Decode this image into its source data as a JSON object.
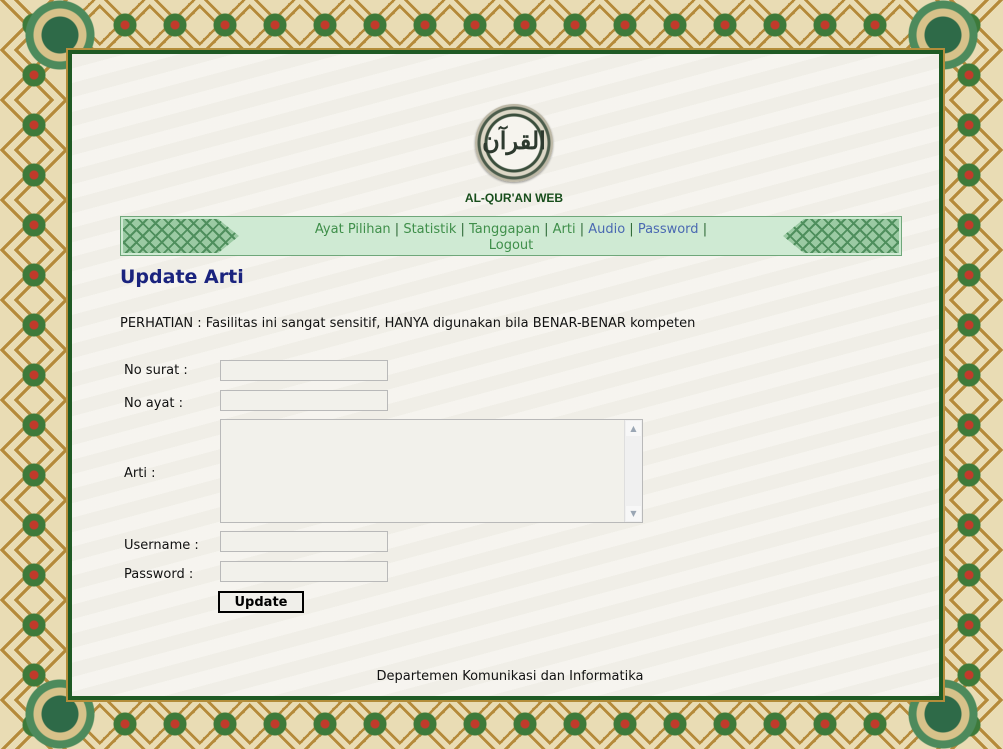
{
  "site": {
    "title": "AL-QUR'AN WEB",
    "logo_text": "القرآن"
  },
  "nav": [
    {
      "label": "Ayat Pilihan",
      "sep": " | "
    },
    {
      "label": "Statistik",
      "sep": " | "
    },
    {
      "label": "Tanggapan",
      "sep": " | "
    },
    {
      "label": "Arti",
      "sep": " | "
    },
    {
      "label": "Audio",
      "sep": " | "
    },
    {
      "label": "Password",
      "sep": " | "
    },
    {
      "label": "Logout",
      "sep": ""
    }
  ],
  "page": {
    "heading": "Update Arti",
    "notice": "PERHATIAN : Fasilitas ini sangat sensitif, HANYA digunakan bila BENAR-BENAR kompeten"
  },
  "form": {
    "no_surat_label": "No surat :",
    "no_surat_value": "",
    "no_ayat_label": "No ayat :",
    "no_ayat_value": "",
    "arti_label": "Arti :",
    "arti_value": "",
    "username_label": "Username :",
    "username_value": "",
    "password_label": "Password :",
    "password_value": "",
    "submit_label": "Update"
  },
  "footer": {
    "text": "Departemen Komunikasi dan Informatika"
  },
  "icons": {
    "scroll_up": "scroll-up-arrow-icon",
    "scroll_down": "scroll-down-arrow-icon"
  },
  "colors": {
    "border_green": "#1f5a24",
    "heading_blue": "#1a237e",
    "nav_bg": "#cfead3"
  }
}
